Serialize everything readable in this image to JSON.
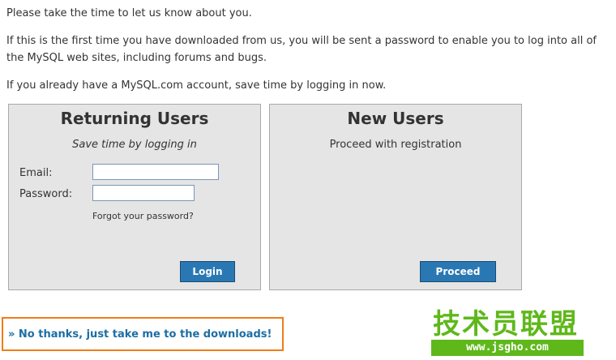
{
  "intro": {
    "line1": "Please take the time to let us know about you.",
    "line2": "If this is the first time you have downloaded from us, you will be sent a password to enable you to log into all of the MySQL web sites, including forums and bugs.",
    "line3": "If you already have a MySQL.com account, save time by logging in now."
  },
  "returning": {
    "title": "Returning Users",
    "subtitle": "Save time by logging in",
    "email_label": "Email:",
    "email_value": "",
    "password_label": "Password:",
    "password_value": "",
    "forgot_link": "Forgot your password?",
    "login_label": "Login"
  },
  "new_users": {
    "title": "New Users",
    "subtitle": "Proceed with registration",
    "proceed_label": "Proceed"
  },
  "skip_link": "» No thanks, just take me to the downloads!",
  "watermark": {
    "chinese": "技术员联盟",
    "url": "www.jsgho.com"
  },
  "colors": {
    "button": "#2a78b3",
    "highlight_border": "#f07d16",
    "link": "#1c6ea4",
    "watermark": "#5fb81a"
  }
}
